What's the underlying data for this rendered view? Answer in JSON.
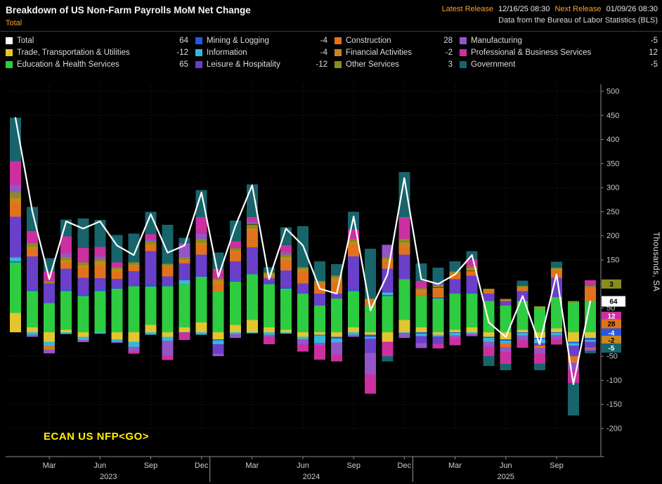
{
  "header": {
    "title": "Breakdown of US Non-Farm Payrolls MoM Net Change",
    "series_label": "Total",
    "latest_release_label": "Latest Release",
    "latest_release_value": "12/16/25 08:30",
    "next_release_label": "Next Release",
    "next_release_value": "01/09/26 08:30",
    "source": "Data from the Bureau of Labor Statistics (BLS)"
  },
  "footer": {
    "command": "ECAN US NFP<GO>"
  },
  "colors": {
    "accent_amber": "#ffa028",
    "command_yellow": "#fff000",
    "background": "#000000"
  },
  "legend": {
    "items": [
      {
        "label": "Total",
        "value": "64",
        "color": "#ffffff"
      },
      {
        "label": "Mining & Logging",
        "value": "-4",
        "color": "#2457e6"
      },
      {
        "label": "Construction",
        "value": "28",
        "color": "#e2711d"
      },
      {
        "label": "Manufacturing",
        "value": "-5",
        "color": "#9455c8"
      },
      {
        "label": "Trade, Transportation & Utilities",
        "value": "-12",
        "color": "#e3c52f"
      },
      {
        "label": "Information",
        "value": "-4",
        "color": "#35b8d8"
      },
      {
        "label": "Financial Activities",
        "value": "-2",
        "color": "#c8861e"
      },
      {
        "label": "Professional & Business Services",
        "value": "12",
        "color": "#cc2fa0"
      },
      {
        "label": "Education & Health Services",
        "value": "65",
        "color": "#2ecc40"
      },
      {
        "label": "Leisure & Hospitality",
        "value": "-12",
        "color": "#6a3fc9"
      },
      {
        "label": "Other Services",
        "value": "3",
        "color": "#8a8c1e"
      },
      {
        "label": "Government",
        "value": "-5",
        "color": "#17646b"
      }
    ]
  },
  "chart_data": {
    "type": "bar",
    "subtype": "stacked-bar-with-total-line",
    "title": "Breakdown of US Non-Farm Payrolls MoM Net Change",
    "ylabel": "Thousands, SA",
    "y_axis": {
      "min": -200,
      "max": 500,
      "tick_step": 50,
      "label": "Thousands, SA"
    },
    "grid": "dotted",
    "legend_position": "top",
    "categories": [
      "Jan 2023",
      "Feb 2023",
      "Mar 2023",
      "Apr 2023",
      "May 2023",
      "Jun 2023",
      "Jul 2023",
      "Aug 2023",
      "Sep 2023",
      "Oct 2023",
      "Nov 2023",
      "Dec 2023",
      "Jan 2024",
      "Feb 2024",
      "Mar 2024",
      "Apr 2024",
      "May 2024",
      "Jun 2024",
      "Jul 2024",
      "Aug 2024",
      "Sep 2024",
      "Oct 2024",
      "Nov 2024",
      "Dec 2024",
      "Jan 2025",
      "Feb 2025",
      "Mar 2025",
      "Apr 2025",
      "May 2025",
      "Jun 2025",
      "Jul 2025",
      "Aug 2025",
      "Sep 2025",
      "Oct 2025",
      "Nov 2025"
    ],
    "x_ticks": [
      {
        "index": 2,
        "label": "Mar"
      },
      {
        "index": 5,
        "label": "Jun"
      },
      {
        "index": 8,
        "label": "Sep"
      },
      {
        "index": 11,
        "label": "Dec"
      },
      {
        "index": 14,
        "label": "Mar"
      },
      {
        "index": 17,
        "label": "Jun"
      },
      {
        "index": 20,
        "label": "Sep"
      },
      {
        "index": 23,
        "label": "Dec"
      },
      {
        "index": 26,
        "label": "Mar"
      },
      {
        "index": 29,
        "label": "Jun"
      },
      {
        "index": 32,
        "label": "Sep"
      }
    ],
    "year_labels": [
      {
        "label": "2023",
        "center_index": 5.5
      },
      {
        "label": "2024",
        "center_index": 17.5
      },
      {
        "label": "2025",
        "center_index": 29
      }
    ],
    "year_separators": [
      12,
      24
    ],
    "series": [
      {
        "name": "Trade, Transportation & Utilities",
        "color": "#e3c52f",
        "values": [
          40,
          10,
          -20,
          5,
          -10,
          0,
          -15,
          -20,
          15,
          -10,
          10,
          20,
          -15,
          15,
          25,
          10,
          5,
          -10,
          -5,
          -10,
          10,
          -5,
          -20,
          25,
          10,
          -5,
          5,
          10,
          -10,
          -15,
          5,
          -12,
          8,
          -20,
          -12
        ]
      },
      {
        "name": "Education & Health Services",
        "color": "#2ecc40",
        "values": [
          105,
          75,
          60,
          80,
          75,
          85,
          90,
          95,
          80,
          95,
          90,
          95,
          85,
          90,
          95,
          90,
          85,
          80,
          55,
          70,
          75,
          55,
          75,
          85,
          65,
          70,
          75,
          70,
          65,
          55,
          60,
          50,
          65,
          62,
          65
        ]
      },
      {
        "name": "Mining & Logging",
        "color": "#2457e6",
        "values": [
          2,
          2,
          1,
          2,
          3,
          2,
          1,
          2,
          3,
          1,
          -1,
          1,
          -2,
          2,
          1,
          2,
          3,
          1,
          -2,
          -3,
          2,
          -5,
          2,
          1,
          -3,
          2,
          -2,
          2,
          -2,
          -3,
          -2,
          -3,
          -2,
          -3,
          -4
        ]
      },
      {
        "name": "Information",
        "color": "#35b8d8",
        "values": [
          8,
          -5,
          -8,
          -4,
          -6,
          -3,
          -5,
          -10,
          -5,
          -8,
          8,
          -5,
          -8,
          -4,
          -2,
          -5,
          -3,
          -5,
          -15,
          -8,
          -5,
          -3,
          5,
          -2,
          -5,
          -4,
          -5,
          -3,
          -8,
          -5,
          -5,
          -8,
          -4,
          -5,
          -4
        ]
      },
      {
        "name": "Leisure & Hospitality",
        "color": "#6a3fc9",
        "values": [
          85,
          70,
          40,
          45,
          35,
          25,
          20,
          30,
          70,
          20,
          35,
          45,
          -20,
          40,
          55,
          10,
          35,
          20,
          25,
          10,
          70,
          -30,
          50,
          50,
          -15,
          -15,
          30,
          35,
          15,
          10,
          20,
          -5,
          40,
          -22,
          -12
        ]
      },
      {
        "name": "Construction",
        "color": "#e2711d",
        "values": [
          28,
          15,
          -5,
          10,
          20,
          25,
          15,
          10,
          12,
          20,
          5,
          20,
          15,
          20,
          35,
          5,
          20,
          25,
          20,
          25,
          25,
          10,
          15,
          15,
          5,
          15,
          10,
          10,
          5,
          -8,
          5,
          -5,
          15,
          -10,
          28
        ]
      },
      {
        "name": "Financial Activities",
        "color": "#c8861e",
        "values": [
          10,
          5,
          -3,
          8,
          5,
          10,
          5,
          3,
          2,
          2,
          3,
          5,
          8,
          2,
          5,
          3,
          8,
          5,
          3,
          8,
          5,
          2,
          5,
          10,
          8,
          5,
          3,
          5,
          3,
          2,
          3,
          2,
          3,
          -3,
          -2
        ]
      },
      {
        "name": "Other Services",
        "color": "#8a8c1e",
        "values": [
          12,
          8,
          5,
          6,
          7,
          5,
          4,
          5,
          6,
          4,
          5,
          8,
          3,
          5,
          8,
          4,
          5,
          4,
          3,
          4,
          6,
          3,
          4,
          8,
          3,
          4,
          3,
          4,
          2,
          2,
          3,
          2,
          3,
          3,
          3
        ]
      },
      {
        "name": "Manufacturing",
        "color": "#9455c8",
        "values": [
          15,
          -5,
          -8,
          8,
          -5,
          5,
          -2,
          -10,
          5,
          -30,
          28,
          10,
          -5,
          -8,
          5,
          -5,
          5,
          -10,
          -5,
          -25,
          -5,
          -45,
          25,
          -10,
          -10,
          5,
          -5,
          -5,
          -10,
          -10,
          -10,
          -12,
          -8,
          -15,
          -5
        ]
      },
      {
        "name": "Professional & Business Services",
        "color": "#cc2fa0",
        "values": [
          50,
          25,
          20,
          35,
          30,
          20,
          10,
          -5,
          10,
          -10,
          -15,
          35,
          20,
          15,
          10,
          -15,
          15,
          -15,
          -30,
          -15,
          20,
          -40,
          -30,
          45,
          15,
          -10,
          -15,
          15,
          -20,
          -25,
          -15,
          -20,
          -12,
          -27,
          12
        ]
      },
      {
        "name": "Government",
        "color": "#17646b",
        "values": [
          90,
          50,
          28,
          35,
          61,
          56,
          57,
          60,
          47,
          81,
          12,
          56,
          34,
          43,
          68,
          11,
          37,
          85,
          41,
          24,
          37,
          103,
          -11,
          93,
          37,
          33,
          21,
          17,
          -20,
          -13,
          11,
          -14,
          12,
          -68,
          -5
        ]
      }
    ],
    "total": {
      "name": "Total",
      "color": "#ffffff",
      "values": [
        445,
        250,
        110,
        230,
        215,
        230,
        180,
        160,
        245,
        165,
        180,
        290,
        115,
        220,
        305,
        110,
        215,
        180,
        90,
        80,
        240,
        45,
        120,
        320,
        110,
        100,
        120,
        160,
        20,
        -10,
        75,
        -25,
        120,
        -108,
        64
      ]
    },
    "badges": [
      {
        "label": "3",
        "color": "#8a8c1e",
        "text_color": "#000000",
        "at": 100
      },
      {
        "label": "64",
        "color": "#ffffff",
        "text_color": "#000000",
        "at": 64
      },
      {
        "label": "12",
        "color": "#cc2fa0",
        "text_color": "#ffffff",
        "at": 33
      },
      {
        "label": "28",
        "color": "#e2711d",
        "text_color": "#000000",
        "at": 17
      },
      {
        "label": "-4",
        "color": "#2457e6",
        "text_color": "#ffffff",
        "at": -2
      },
      {
        "label": "-2",
        "color": "#c8861e",
        "text_color": "#000000",
        "at": -17
      },
      {
        "label": "-5",
        "color": "#17646b",
        "text_color": "#ffffff",
        "at": -33
      }
    ]
  }
}
